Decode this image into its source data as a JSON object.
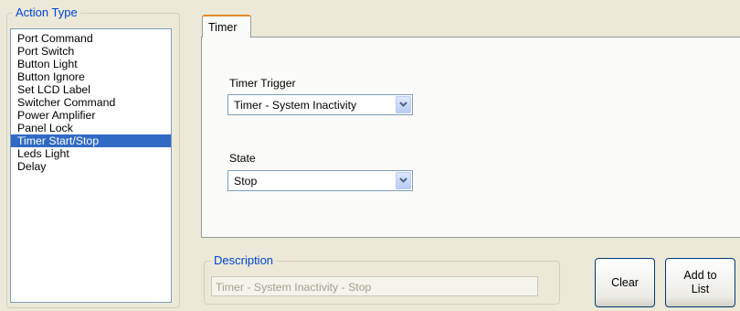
{
  "action_type": {
    "title": "Action Type",
    "items": [
      {
        "label": "Port Command",
        "selected": false
      },
      {
        "label": "Port Switch",
        "selected": false
      },
      {
        "label": "Button Light",
        "selected": false
      },
      {
        "label": "Button Ignore",
        "selected": false
      },
      {
        "label": "Set LCD Label",
        "selected": false
      },
      {
        "label": "Switcher Command",
        "selected": false
      },
      {
        "label": "Power Amplifier",
        "selected": false
      },
      {
        "label": "Panel Lock",
        "selected": false
      },
      {
        "label": "Timer Start/Stop",
        "selected": true
      },
      {
        "label": "Leds Light",
        "selected": false
      },
      {
        "label": "Delay",
        "selected": false
      }
    ]
  },
  "tab": {
    "label": "Timer",
    "timer_trigger": {
      "label": "Timer Trigger",
      "value": "Timer - System Inactivity"
    },
    "state": {
      "label": "State",
      "value": "Stop"
    }
  },
  "description": {
    "title": "Description",
    "value": "Timer - System Inactivity - Stop"
  },
  "buttons": {
    "clear": "Clear",
    "add_to_list_line1": "Add to",
    "add_to_list_line2": "List"
  },
  "colors": {
    "group_title": "#0046d5",
    "selection": "#316ac5",
    "tab_accent": "#e68b2c"
  }
}
